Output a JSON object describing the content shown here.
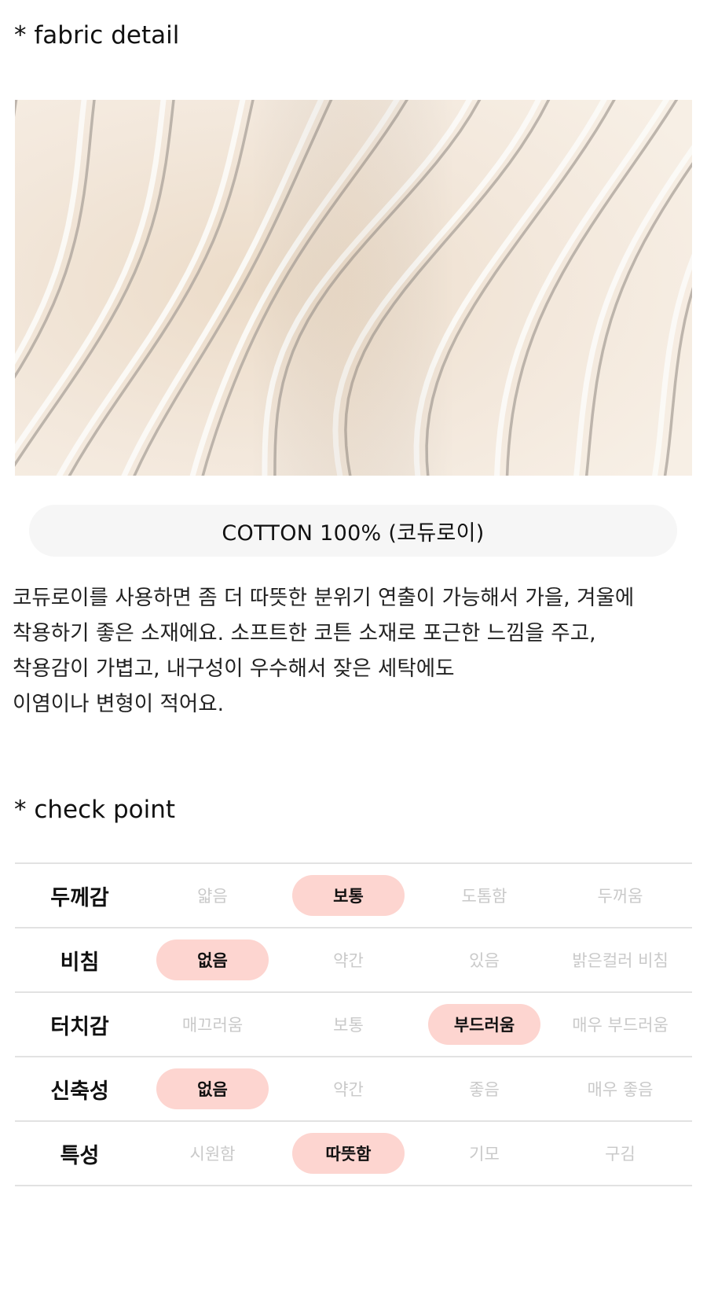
{
  "fabric_detail": {
    "title": "* fabric detail",
    "material": "COTTON 100% (코듀로이)",
    "description_lines": [
      "코듀로이를 사용하면 좀 더 따뜻한 분위기 연출이 가능해서 가을, 겨울에",
      "착용하기 좋은 소재에요. 소프트한 코튼 소재로 포근한 느낌을 주고,",
      "착용감이 가볍고, 내구성이 우수해서 잦은 세탁에도",
      "이염이나 변형이 적어요."
    ]
  },
  "check_point": {
    "title": "* check point",
    "rows": [
      {
        "label": "두께감",
        "options": [
          "얇음",
          "보통",
          "도톰함",
          "두꺼움"
        ],
        "selected": 1
      },
      {
        "label": "비침",
        "options": [
          "없음",
          "약간",
          "있음",
          "밝은컬러 비침"
        ],
        "selected": 0
      },
      {
        "label": "터치감",
        "options": [
          "매끄러움",
          "보통",
          "부드러움",
          "매우 부드러움"
        ],
        "selected": 2
      },
      {
        "label": "신축성",
        "options": [
          "없음",
          "약간",
          "좋음",
          "매우 좋음"
        ],
        "selected": 0
      },
      {
        "label": "특성",
        "options": [
          "시원함",
          "따뜻함",
          "기모",
          "구김"
        ],
        "selected": 1
      }
    ]
  },
  "colors": {
    "selected_pill": "#fdd5d0",
    "unselected_text": "#c9c9c9",
    "material_pill_bg": "#f6f6f6",
    "fabric_base": "#f2e9df",
    "stripe_white": "#fbfaf7",
    "stripe_gray": "#aaa29a"
  }
}
